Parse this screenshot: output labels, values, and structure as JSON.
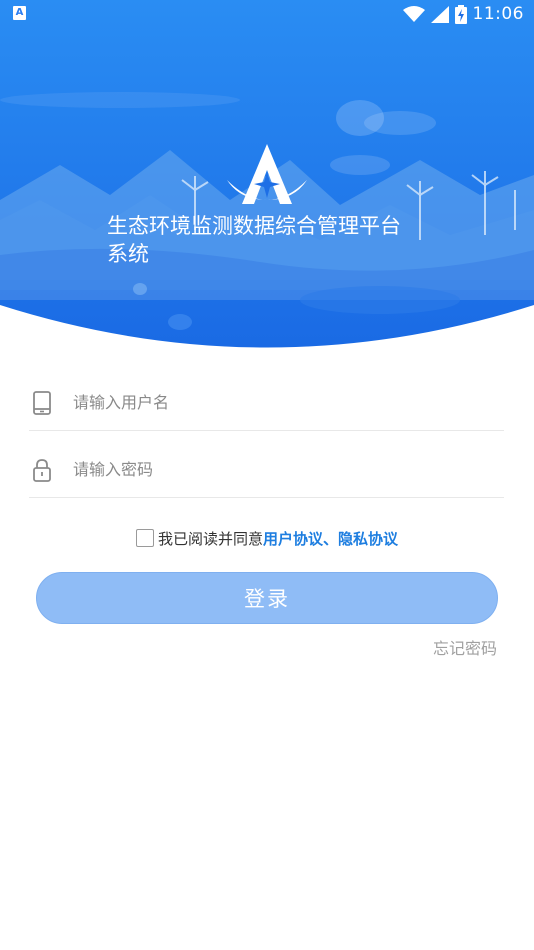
{
  "status_bar": {
    "app_icon_letter": "A",
    "time": "11:06",
    "icons": [
      "wifi-icon",
      "signal-icon",
      "battery-charging-icon"
    ]
  },
  "header": {
    "logo_icon": "star-a-logo-icon",
    "title": "生态环境监测数据综合管理平台系统",
    "gradient_top": "#2a8cf2",
    "gradient_bottom": "#1e6fe6"
  },
  "form": {
    "username": {
      "icon": "phone-icon",
      "value": "",
      "placeholder": "请输入用户名"
    },
    "password": {
      "icon": "lock-icon",
      "value": "",
      "placeholder": "请输入密码"
    },
    "agreement": {
      "checked": false,
      "prefix": "我已阅读并同意",
      "user_agreement": "用户协议",
      "separator": "、",
      "privacy_policy": "隐私协议"
    },
    "login_label": "登录",
    "forgot_label": "忘记密码"
  },
  "colors": {
    "accent": "#1e7ee0",
    "button": "#8fbcf6",
    "placeholder": "#8a8a8a"
  }
}
